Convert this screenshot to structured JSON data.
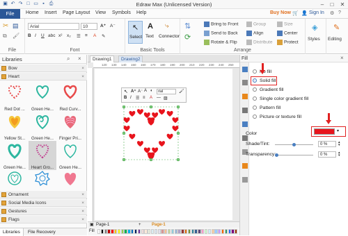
{
  "window": {
    "title": "Edraw Max (Unlicensed Version)"
  },
  "menu": {
    "file": "File",
    "tabs": [
      "Home",
      "Insert",
      "Page Layout",
      "View",
      "Symbols",
      "Help"
    ],
    "buy_now": "Buy Now",
    "sign_in": "Sign In"
  },
  "ribbon": {
    "font_name": "Arial",
    "font_size": "10",
    "group_file": "File",
    "group_font": "Font",
    "group_basic": "Basic Tools",
    "group_arrange": "Arrange",
    "select": "Select",
    "text": "Text",
    "connector": "Connector",
    "bring_front": "Bring to Front",
    "send_back": "Send to Back",
    "rotate_flip": "Rotate & Flip",
    "group": "Group",
    "align": "Align",
    "distribute": "Distribute",
    "size": "Size",
    "center": "Center",
    "protect": "Protect",
    "styles": "Styles",
    "editing": "Editing"
  },
  "libraries": {
    "title": "Libraries",
    "categories_top": [
      "Bow",
      "Heart"
    ],
    "shapes": [
      {
        "label": "Red Dot ..."
      },
      {
        "label": "Green He..."
      },
      {
        "label": "Red Curv..."
      },
      {
        "label": "Yellow St..."
      },
      {
        "label": "Green He..."
      },
      {
        "label": "Finger Pri..."
      },
      {
        "label": "Green He..."
      },
      {
        "label": "Heart Gro..."
      },
      {
        "label": "Green He..."
      },
      {
        "label": ""
      },
      {
        "label": ""
      },
      {
        "label": ""
      }
    ],
    "categories_bottom": [
      "Ornament",
      "Social Media Icons",
      "Gestures",
      "Flags"
    ],
    "bottom_tabs": [
      "Libraries",
      "File Recovery"
    ]
  },
  "canvas": {
    "doc_tabs": [
      "Drawing1",
      "Drawing2"
    ],
    "ruler_marks": [
      "120",
      "130",
      "140",
      "150",
      "160",
      "170",
      "180",
      "190",
      "200",
      "210",
      "220",
      "230",
      "240",
      "250",
      "260"
    ],
    "page_tab": "Page-1",
    "page_tab_active": "Page-1",
    "fill_label": "Fill",
    "mini_font": "rial"
  },
  "fill_panel": {
    "title": "Fill",
    "options": [
      "No fill",
      "Solid fill",
      "Gradient fill",
      "Single color gradient fill",
      "Pattern fill",
      "Picture or texture fill"
    ],
    "selected": "Solid fill",
    "color_label": "Color",
    "shade_label": "Shade/Tint:",
    "shade_value": "0 %",
    "transparency_label": "Transparency:",
    "transparency_value": "0 %",
    "color_value": "#e8141c"
  },
  "colors": {
    "accent": "#2b5797",
    "highlight": "#e02020",
    "heart": "#e8141c"
  }
}
